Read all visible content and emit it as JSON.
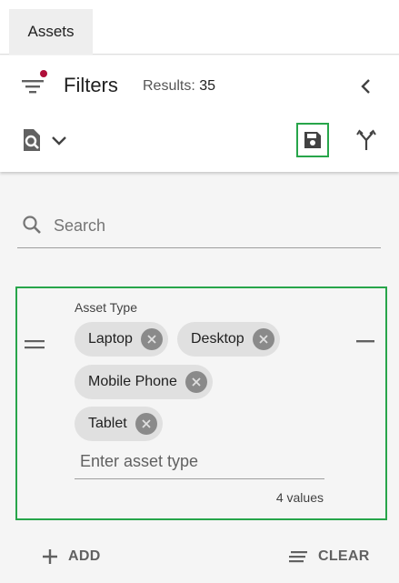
{
  "tabs": [
    {
      "label": "Assets"
    }
  ],
  "header": {
    "title": "Filters",
    "results_label": "Results:",
    "results_count": "35"
  },
  "search": {
    "placeholder": "Search"
  },
  "filter_card": {
    "label": "Asset Type",
    "chips": [
      {
        "label": "Laptop"
      },
      {
        "label": "Desktop"
      },
      {
        "label": "Mobile Phone"
      },
      {
        "label": "Tablet"
      }
    ],
    "input_placeholder": "Enter asset type",
    "count_text": "4 values"
  },
  "footer": {
    "add_label": "ADD",
    "clear_label": "CLEAR"
  },
  "colors": {
    "highlight": "#27a54a",
    "notification_dot": "#b0103a",
    "chip_bg": "#e0e0e0"
  }
}
